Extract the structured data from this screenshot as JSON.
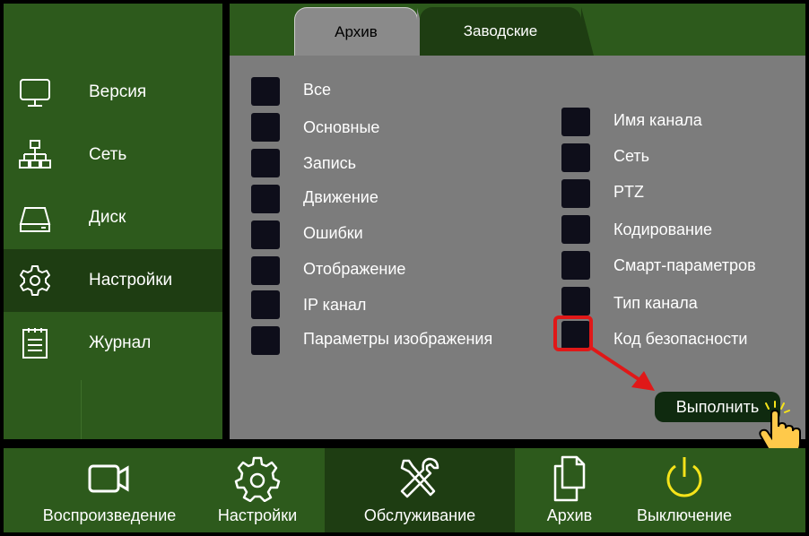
{
  "sidebar": {
    "items": [
      {
        "label": "Версия",
        "icon": "monitor-icon"
      },
      {
        "label": "Сеть",
        "icon": "network-icon"
      },
      {
        "label": "Диск",
        "icon": "disk-icon"
      },
      {
        "label": "Настройки",
        "icon": "gear-icon"
      },
      {
        "label": "Журнал",
        "icon": "journal-icon"
      }
    ]
  },
  "tabs": [
    {
      "label": "Архив"
    },
    {
      "label": "Заводские"
    }
  ],
  "options_left": [
    {
      "label": "Все"
    },
    {
      "label": "Основные"
    },
    {
      "label": "Запись"
    },
    {
      "label": "Движение"
    },
    {
      "label": "Ошибки"
    },
    {
      "label": "Отображение"
    },
    {
      "label": "IP канал"
    },
    {
      "label": "Параметры изображения"
    }
  ],
  "options_right": [
    {
      "label": "Имя канала"
    },
    {
      "label": "Сеть"
    },
    {
      "label": "PTZ"
    },
    {
      "label": "Кодирование"
    },
    {
      "label": "Смарт-параметров"
    },
    {
      "label": "Тип канала"
    },
    {
      "label": "Код безопасности"
    }
  ],
  "execute_label": "Выполнить",
  "bottom_nav": [
    {
      "label": "Воспроизведение",
      "icon": "camera-icon"
    },
    {
      "label": "Настройки",
      "icon": "gear-icon"
    },
    {
      "label": "Обслуживание",
      "icon": "tools-icon"
    },
    {
      "label": "Архив",
      "icon": "copy-icon"
    },
    {
      "label": "Выключение",
      "icon": "power-icon"
    }
  ],
  "colors": {
    "panel_green": "#2d5a1c",
    "active_green": "#1e3d12",
    "content_gray": "#7c7c7c",
    "checkbox": "#0e0e1a",
    "highlight_red": "#e01818",
    "power_yellow": "#f5e31a"
  }
}
